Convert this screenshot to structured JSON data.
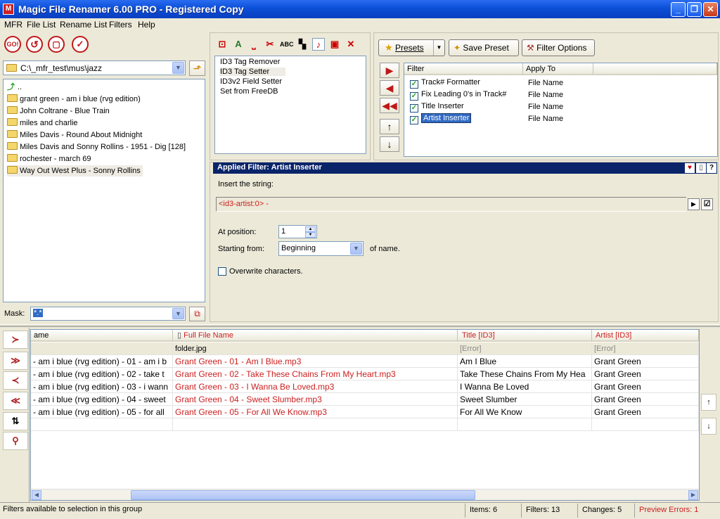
{
  "window": {
    "title": "Magic File Renamer 6.00 PRO - Registered Copy",
    "app_icon_letter": "M"
  },
  "menu": [
    "MFR",
    "File List",
    "Rename List",
    "Filters",
    "Help"
  ],
  "left_panel": {
    "toolbar": [
      {
        "icon": "go-icon",
        "label": "GO!"
      },
      {
        "icon": "undo-icon",
        "label": "↺"
      },
      {
        "icon": "clipboard-icon",
        "label": "▢"
      },
      {
        "icon": "checkmark-icon",
        "label": "✓"
      }
    ],
    "path": "C:\\_mfr_test\\mus\\jazz",
    "tree": [
      "..",
      "grant green - am i blue (rvg edition)",
      "John Coltrane - Blue Train",
      "miles and charlie",
      "Miles Davis - Round About Midnight",
      "Miles Davis and Sonny Rollins - 1951 - Dig [128]",
      "rochester - march 69",
      "Way Out West Plus - Sonny Rollins"
    ],
    "mask_label": "Mask:",
    "mask_value": "*.*"
  },
  "filters_panel": {
    "icons": [
      "remove-tag-icon",
      "text-case-icon",
      "underscore-icon",
      "cut-icon",
      "abc-icon",
      "checker-icon",
      "music-note-icon",
      "building-icon",
      "tools-icon"
    ],
    "list": [
      "ID3 Tag Remover",
      "ID3 Tag Setter",
      "ID3v2 Field Setter",
      "Set from FreeDB"
    ]
  },
  "presets": {
    "presets_label": "Presets",
    "save_label": "Save Preset",
    "options_label": "Filter Options",
    "col_filter": "Filter",
    "col_apply": "Apply To",
    "rows": [
      {
        "name": "Track# Formatter",
        "apply": "File Name",
        "checked": true
      },
      {
        "name": "Fix Leading 0's in Track#",
        "apply": "File Name",
        "checked": true
      },
      {
        "name": "Title Inserter",
        "apply": "File Name",
        "checked": true
      },
      {
        "name": "Artist Inserter",
        "apply": "File Name",
        "checked": true
      }
    ]
  },
  "applied": {
    "header": "Applied Filter: Artist Inserter",
    "insert_label": "Insert the string:",
    "insert_value": "<id3-artist:0> -",
    "position_label": "At position:",
    "position_value": "1",
    "starting_label": "Starting from:",
    "starting_value": "Beginning",
    "of_name": "of name.",
    "overwrite_label": "Overwrite characters."
  },
  "file_list": {
    "headers": [
      "ame",
      "Full File Name",
      "Title [ID3]",
      "Artist [ID3]"
    ],
    "rows": [
      [
        "",
        "folder.jpg",
        "[Error]",
        "[Error]"
      ],
      [
        " - am i blue (rvg edition) - 01 - am i b",
        "Grant Green - 01 - Am I Blue.mp3",
        "Am I Blue",
        "Grant Green"
      ],
      [
        " - am i blue (rvg edition) - 02 - take t",
        "Grant Green - 02 - Take These Chains From My Heart.mp3",
        "Take These Chains From My Hea",
        "Grant Green"
      ],
      [
        " - am i blue (rvg edition) - 03 - i wann",
        "Grant Green - 03 - I Wanna Be Loved.mp3",
        "I Wanna Be Loved",
        "Grant Green"
      ],
      [
        " - am i blue (rvg edition) - 04 - sweet",
        "Grant Green - 04 - Sweet Slumber.mp3",
        "Sweet Slumber",
        "Grant Green"
      ],
      [
        " - am i blue (rvg edition) - 05 - for all",
        "Grant Green - 05 - For All We Know.mp3",
        "For All We Know",
        "Grant Green"
      ]
    ]
  },
  "status": {
    "message": "Filters available to selection in this group",
    "items": "Items: 6",
    "filters": "Filters: 13",
    "changes": "Changes: 5",
    "errors": "Preview Errors: 1"
  },
  "colors": {
    "title_bar": "#0b4fd8",
    "accent_red": "#cc2020",
    "selection": "#316ac5",
    "applied_header": "#0a246a"
  }
}
